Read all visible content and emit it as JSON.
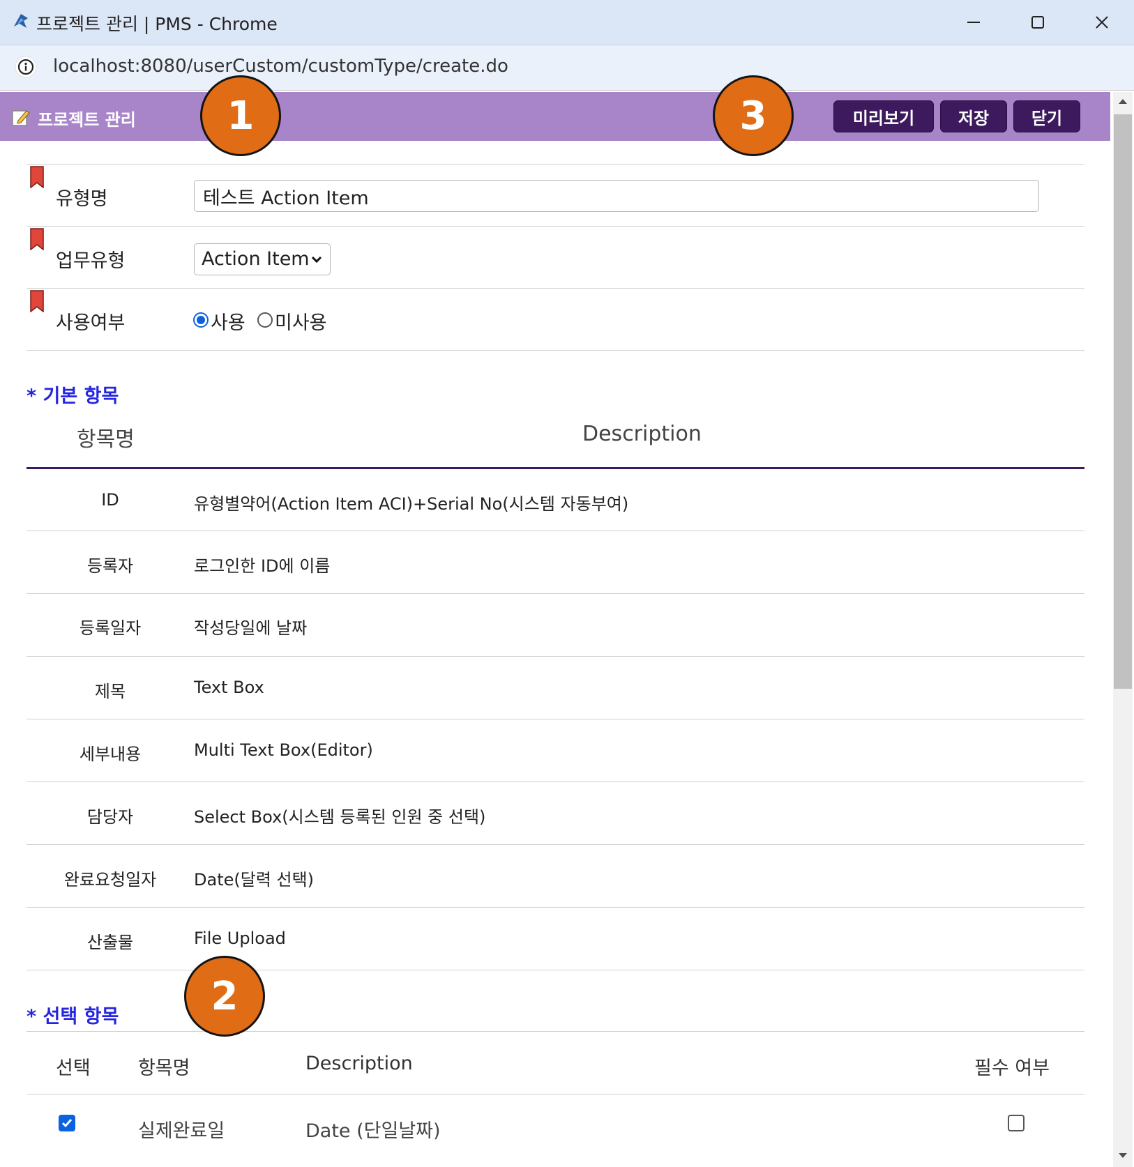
{
  "window": {
    "title": "프로젝트 관리 | PMS - Chrome",
    "url": "localhost:8080/userCustom/customType/create.do"
  },
  "header": {
    "title": "프로젝트 관리",
    "buttons": {
      "preview": "미리보기",
      "save": "저장",
      "close": "닫기"
    }
  },
  "form": {
    "type_name": {
      "label": "유형명",
      "value": "테스트 Action Item"
    },
    "work_type": {
      "label": "업무유형",
      "value": "Action Item"
    },
    "use_yn": {
      "label": "사용여부",
      "options": [
        "사용",
        "미사용"
      ],
      "selected": "사용"
    }
  },
  "basic": {
    "title": "* 기본 항목",
    "headers": {
      "name": "항목명",
      "desc": "Description"
    },
    "rows": [
      {
        "name": "ID",
        "desc": "유형별약어(Action Item ACI)+Serial No(시스템 자동부여)"
      },
      {
        "name": "등록자",
        "desc": "로그인한 ID에 이름"
      },
      {
        "name": "등록일자",
        "desc": "작성당일에 날짜"
      },
      {
        "name": "제목",
        "desc": "Text Box"
      },
      {
        "name": "세부내용",
        "desc": "Multi Text Box(Editor)"
      },
      {
        "name": "담당자",
        "desc": "Select Box(시스템 등록된 인원 중 선택)"
      },
      {
        "name": "완료요청일자",
        "desc": "Date(달력 선택)"
      },
      {
        "name": "산출물",
        "desc": "File Upload"
      }
    ]
  },
  "optional": {
    "title": "* 선택 항목",
    "headers": {
      "select": "선택",
      "name": "항목명",
      "desc": "Description",
      "required": "필수 여부"
    },
    "rows": [
      {
        "selected": true,
        "name": "실제완료일",
        "desc": "Date (단일날짜)",
        "required": false
      }
    ]
  },
  "annotations": [
    "1",
    "2",
    "3"
  ],
  "colors": {
    "header_bg": "#a884c8",
    "button_bg": "#3d1a5e",
    "section_title": "#2525e0",
    "badge": "#e06c16"
  },
  "icons": [
    "app-icon",
    "site-info-icon",
    "minimize-icon",
    "maximize-icon",
    "close-icon",
    "edit-icon",
    "bookmark-icon",
    "chevron-down-icon",
    "checkbox-icon"
  ]
}
